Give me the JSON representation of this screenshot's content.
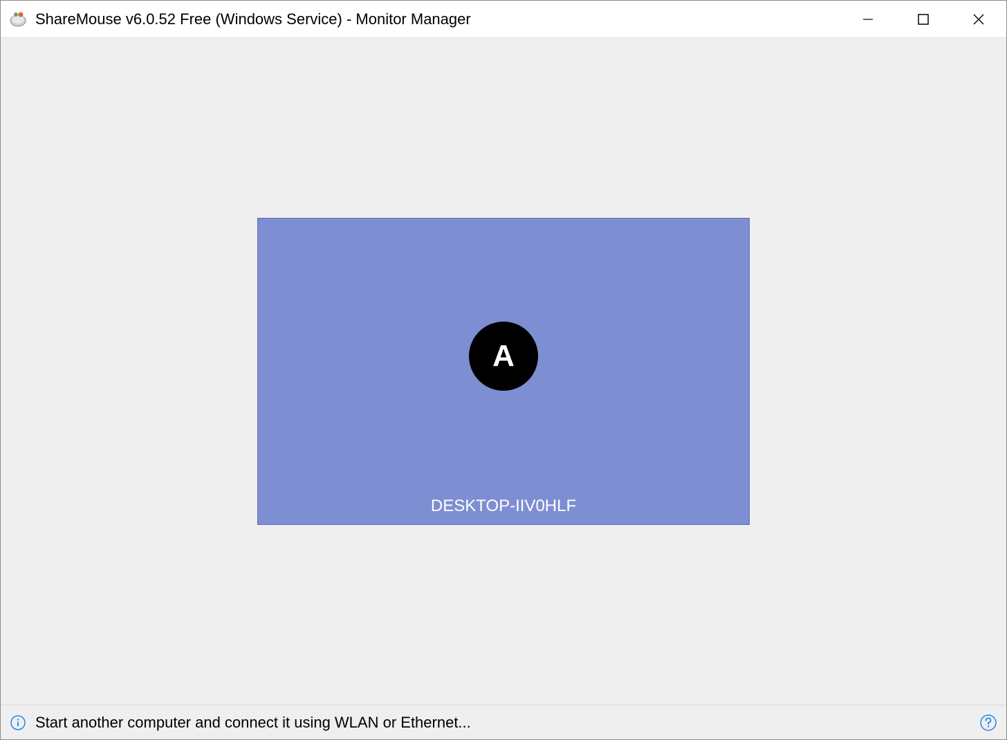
{
  "titlebar": {
    "title": "ShareMouse v6.0.52 Free (Windows Service) - Monitor Manager"
  },
  "monitor": {
    "label": "A",
    "name": "DESKTOP-IIV0HLF"
  },
  "statusbar": {
    "text": "Start another computer and connect it using WLAN or Ethernet..."
  }
}
